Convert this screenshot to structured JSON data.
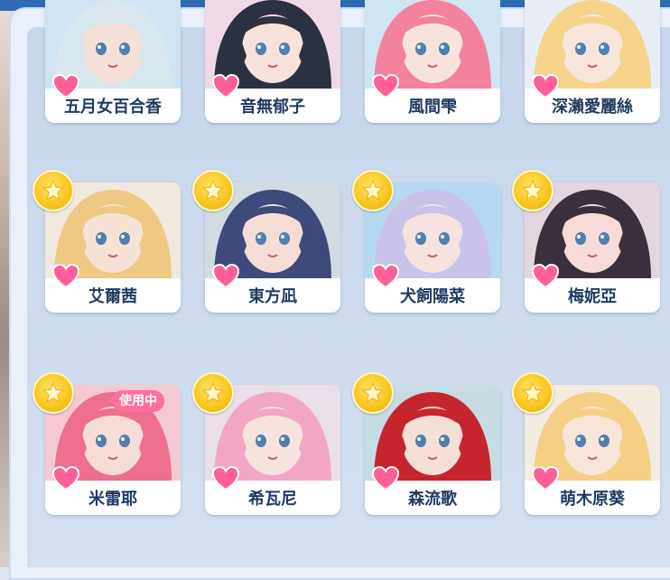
{
  "characters": [
    {
      "name": "五月女百合香",
      "starred": false,
      "in_use": false,
      "hair": "#d8e6ee",
      "bg": "#cfe3f2",
      "skin": "#f6e1d9"
    },
    {
      "name": "音無郁子",
      "starred": false,
      "in_use": false,
      "hair": "#2c3142",
      "bg": "#f0d9e6",
      "skin": "#f7e2dc"
    },
    {
      "name": "風間雫",
      "starred": false,
      "in_use": false,
      "hair": "#f2829e",
      "bg": "#cfe6f2",
      "skin": "#f8e4dd"
    },
    {
      "name": "深瀨愛麗絲",
      "starred": false,
      "in_use": false,
      "hair": "#f4d48a",
      "bg": "#e9eef6",
      "skin": "#f8e6dc"
    },
    {
      "name": "艾爾茜",
      "starred": true,
      "in_use": false,
      "hair": "#efc884",
      "bg": "#f1e9dd",
      "skin": "#f7e2d6"
    },
    {
      "name": "東方凪",
      "starred": true,
      "in_use": false,
      "hair": "#3e4a7a",
      "bg": "#d3dbe2",
      "skin": "#f4ddd4"
    },
    {
      "name": "犬飼陽菜",
      "starred": true,
      "in_use": false,
      "hair": "#c9c3ea",
      "bg": "#b7d9ef",
      "skin": "#f6e2de"
    },
    {
      "name": "梅妮亞",
      "starred": true,
      "in_use": false,
      "hair": "#3a2f3c",
      "bg": "#e3d6de",
      "skin": "#f6dcd8"
    },
    {
      "name": "米雷耶",
      "starred": true,
      "in_use": true,
      "hair": "#ee6f8f",
      "bg": "#f4c9d3",
      "skin": "#f7ddd6"
    },
    {
      "name": "希瓦尼",
      "starred": true,
      "in_use": false,
      "hair": "#f3a6c6",
      "bg": "#eadfe8",
      "skin": "#f8e4de"
    },
    {
      "name": "森流歌",
      "starred": true,
      "in_use": false,
      "hair": "#c7252e",
      "bg": "#c6dce2",
      "skin": "#f6e0d6"
    },
    {
      "name": "萌木原葵",
      "starred": true,
      "in_use": false,
      "hair": "#f6cf86",
      "bg": "#f4ece0",
      "skin": "#f9e5da"
    }
  ],
  "in_use_label": "使用中",
  "colors": {
    "heart": "#ff5f98",
    "star": "#f7c51e",
    "name_text": "#1f3b63",
    "top_bar": "#2f6ab3",
    "badge": "#ff6f9a"
  },
  "icons": {
    "favorite": "heart-icon",
    "rank": "star-icon"
  }
}
